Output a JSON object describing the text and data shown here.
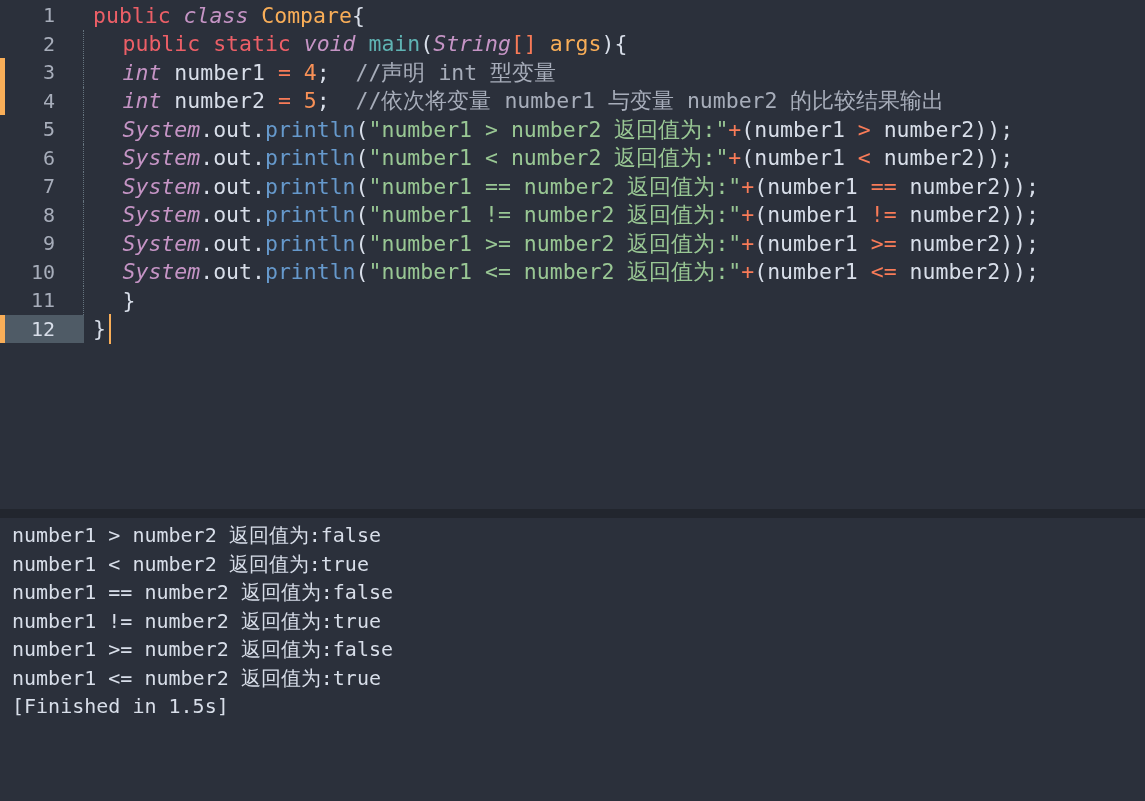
{
  "editor": {
    "lines": [
      {
        "number": "1",
        "modified": false,
        "selected": false,
        "indented": false,
        "tokens": [
          {
            "kind": "keyword",
            "text": "public "
          },
          {
            "kind": "storage",
            "text": "class "
          },
          {
            "kind": "classname",
            "text": "Compare"
          },
          {
            "kind": "plain",
            "text": "{"
          }
        ]
      },
      {
        "number": "2",
        "modified": false,
        "selected": false,
        "indented": true,
        "tokens": [
          {
            "kind": "keyword",
            "text": "public static "
          },
          {
            "kind": "storage",
            "text": "void "
          },
          {
            "kind": "function",
            "text": "main"
          },
          {
            "kind": "plain",
            "text": "("
          },
          {
            "kind": "storage",
            "text": "String"
          },
          {
            "kind": "operator",
            "text": "[] "
          },
          {
            "kind": "param",
            "text": "args"
          },
          {
            "kind": "plain",
            "text": "){"
          }
        ]
      },
      {
        "number": "3",
        "modified": true,
        "selected": false,
        "indented": true,
        "tokens": [
          {
            "kind": "storage",
            "text": "int"
          },
          {
            "kind": "plain",
            "text": " number1 "
          },
          {
            "kind": "operator",
            "text": "= "
          },
          {
            "kind": "number",
            "text": "4"
          },
          {
            "kind": "plain",
            "text": ";  "
          },
          {
            "kind": "comment",
            "text": "//声明 int 型变量"
          }
        ]
      },
      {
        "number": "4",
        "modified": true,
        "selected": false,
        "indented": true,
        "tokens": [
          {
            "kind": "storage",
            "text": "int"
          },
          {
            "kind": "plain",
            "text": " number2 "
          },
          {
            "kind": "operator",
            "text": "= "
          },
          {
            "kind": "number",
            "text": "5"
          },
          {
            "kind": "plain",
            "text": ";  "
          },
          {
            "kind": "comment",
            "text": "//依次将变量 number1 与变量 number2 的比较结果输出"
          }
        ]
      },
      {
        "number": "5",
        "modified": false,
        "selected": false,
        "indented": true,
        "tokens": [
          {
            "kind": "storage",
            "text": "System"
          },
          {
            "kind": "plain",
            "text": ".out."
          },
          {
            "kind": "method",
            "text": "println"
          },
          {
            "kind": "plain",
            "text": "("
          },
          {
            "kind": "string",
            "text": "\"number1 > number2 返回值为:\""
          },
          {
            "kind": "operator",
            "text": "+"
          },
          {
            "kind": "plain",
            "text": "(number1 "
          },
          {
            "kind": "operator",
            "text": ">"
          },
          {
            "kind": "plain",
            "text": " number2));"
          }
        ]
      },
      {
        "number": "6",
        "modified": false,
        "selected": false,
        "indented": true,
        "tokens": [
          {
            "kind": "storage",
            "text": "System"
          },
          {
            "kind": "plain",
            "text": ".out."
          },
          {
            "kind": "method",
            "text": "println"
          },
          {
            "kind": "plain",
            "text": "("
          },
          {
            "kind": "string",
            "text": "\"number1 < number2 返回值为:\""
          },
          {
            "kind": "operator",
            "text": "+"
          },
          {
            "kind": "plain",
            "text": "(number1 "
          },
          {
            "kind": "operator",
            "text": "<"
          },
          {
            "kind": "plain",
            "text": " number2));"
          }
        ]
      },
      {
        "number": "7",
        "modified": false,
        "selected": false,
        "indented": true,
        "tokens": [
          {
            "kind": "storage",
            "text": "System"
          },
          {
            "kind": "plain",
            "text": ".out."
          },
          {
            "kind": "method",
            "text": "println"
          },
          {
            "kind": "plain",
            "text": "("
          },
          {
            "kind": "string",
            "text": "\"number1 == number2 返回值为:\""
          },
          {
            "kind": "operator",
            "text": "+"
          },
          {
            "kind": "plain",
            "text": "(number1 "
          },
          {
            "kind": "operator",
            "text": "=="
          },
          {
            "kind": "plain",
            "text": " number2));"
          }
        ]
      },
      {
        "number": "8",
        "modified": false,
        "selected": false,
        "indented": true,
        "tokens": [
          {
            "kind": "storage",
            "text": "System"
          },
          {
            "kind": "plain",
            "text": ".out."
          },
          {
            "kind": "method",
            "text": "println"
          },
          {
            "kind": "plain",
            "text": "("
          },
          {
            "kind": "string",
            "text": "\"number1 != number2 返回值为:\""
          },
          {
            "kind": "operator",
            "text": "+"
          },
          {
            "kind": "plain",
            "text": "(number1 "
          },
          {
            "kind": "operator",
            "text": "!="
          },
          {
            "kind": "plain",
            "text": " number2));"
          }
        ]
      },
      {
        "number": "9",
        "modified": false,
        "selected": false,
        "indented": true,
        "tokens": [
          {
            "kind": "storage",
            "text": "System"
          },
          {
            "kind": "plain",
            "text": ".out."
          },
          {
            "kind": "method",
            "text": "println"
          },
          {
            "kind": "plain",
            "text": "("
          },
          {
            "kind": "string",
            "text": "\"number1 >= number2 返回值为:\""
          },
          {
            "kind": "operator",
            "text": "+"
          },
          {
            "kind": "plain",
            "text": "(number1 "
          },
          {
            "kind": "operator",
            "text": ">="
          },
          {
            "kind": "plain",
            "text": " number2));"
          }
        ]
      },
      {
        "number": "10",
        "modified": false,
        "selected": false,
        "indented": true,
        "tokens": [
          {
            "kind": "storage",
            "text": "System"
          },
          {
            "kind": "plain",
            "text": ".out."
          },
          {
            "kind": "method",
            "text": "println"
          },
          {
            "kind": "plain",
            "text": "("
          },
          {
            "kind": "string",
            "text": "\"number1 <= number2 返回值为:\""
          },
          {
            "kind": "operator",
            "text": "+"
          },
          {
            "kind": "plain",
            "text": "(number1 "
          },
          {
            "kind": "operator",
            "text": "<="
          },
          {
            "kind": "plain",
            "text": " number2));"
          }
        ]
      },
      {
        "number": "11",
        "modified": false,
        "selected": false,
        "indented": true,
        "tokens": [
          {
            "kind": "plain",
            "text": "}"
          }
        ]
      },
      {
        "number": "12",
        "modified": true,
        "selected": true,
        "indented": false,
        "tokens": [
          {
            "kind": "plain",
            "text": "}"
          }
        ]
      }
    ]
  },
  "output": {
    "lines": [
      "number1 > number2 返回值为:false",
      "number1 < number2 返回值为:true",
      "number1 == number2 返回值为:false",
      "number1 != number2 返回值为:true",
      "number1 >= number2 返回值为:false",
      "number1 <= number2 返回值为:true",
      "[Finished in 1.5s]"
    ]
  }
}
